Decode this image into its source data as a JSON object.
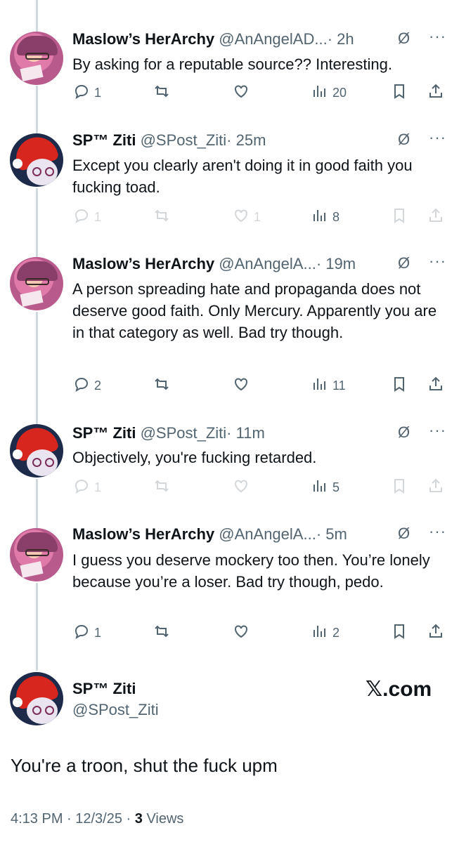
{
  "tweets": [
    {
      "name": "Maslow’s HerArchy",
      "handle": "@AnAngelAD...",
      "time": "· 2h",
      "text": "By asking for a reputable source?? Interesting.",
      "replies": "1",
      "retweets": "",
      "likes": "",
      "views": "20",
      "avatar": "pink-avatar",
      "faded": false
    },
    {
      "name": "SP™ Ziti",
      "handle": "@SPost_Ziti",
      "time": "· 25m",
      "text": "Except you clearly aren't doing it in good faith you fucking toad.",
      "replies": "1",
      "retweets": "",
      "likes": "1",
      "views": "8",
      "avatar": "ziti-avatar",
      "faded": true
    },
    {
      "name": "Maslow’s HerArchy",
      "handle": "@AnAngelA...",
      "time": "· 19m",
      "text": "A person spreading hate and propaganda does not deserve good faith. Only Mercury. Apparently you are in that category as well. Bad try though.",
      "replies": "2",
      "retweets": "",
      "likes": "",
      "views": "11",
      "avatar": "pink-avatar",
      "faded": false
    },
    {
      "name": "SP™ Ziti",
      "handle": "@SPost_Ziti",
      "time": "· 11m",
      "text": "Objectively, you're fucking retarded.",
      "replies": "1",
      "retweets": "",
      "likes": "",
      "views": "5",
      "avatar": "ziti-avatar",
      "faded": true
    },
    {
      "name": "Maslow’s HerArchy",
      "handle": "@AnAngelA...",
      "time": "· 5m",
      "text": "I guess you deserve mockery too then. You’re lonely because you’re a loser. Bad try though, pedo.",
      "replies": "1",
      "retweets": "",
      "likes": "",
      "views": "2",
      "avatar": "pink-avatar",
      "faded": false
    }
  ],
  "main": {
    "name": "SP™ Ziti",
    "handle": "@SPost_Ziti",
    "brand": "𝕏.com",
    "text": "You're a troon, shut the fuck upm",
    "timestamp": "4:13 PM · 12/3/25 · ",
    "views_count": "3",
    "views_label": " Views"
  },
  "icons": {
    "grok": "slashed-circle-icon",
    "more": "more-dots-icon",
    "reply": "reply-icon",
    "retweet": "retweet-icon",
    "like": "heart-icon",
    "views": "views-icon",
    "bookmark": "bookmark-icon",
    "share": "share-icon"
  },
  "colors": {
    "text": "#0f1419",
    "secondary": "#536471",
    "thread": "#cfd9de"
  }
}
